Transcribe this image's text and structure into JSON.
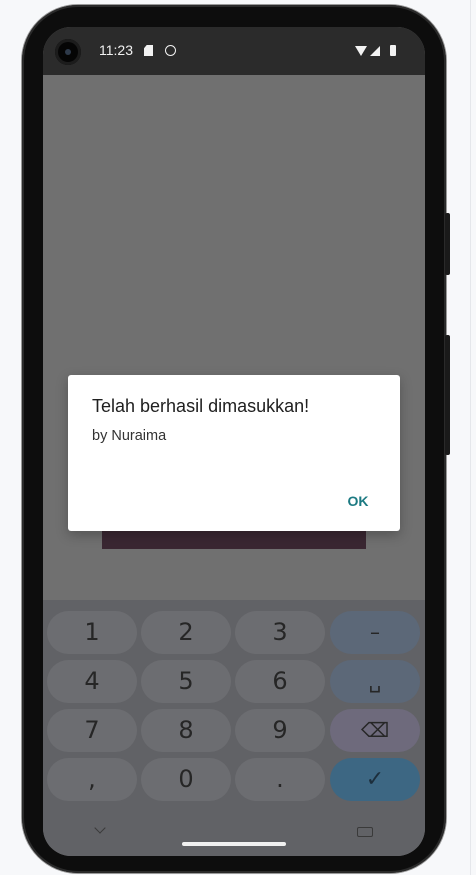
{
  "status_bar": {
    "time": "11:23",
    "icons": [
      "sd-card-icon",
      "face-icon",
      "wifi-icon",
      "signal-icon",
      "battery-icon"
    ]
  },
  "dialog": {
    "title": "Telah berhasil dimasukkan!",
    "message": "by Nuraima",
    "ok_label": "OK"
  },
  "keyboard": {
    "rows": [
      [
        "1",
        "2",
        "3",
        "–"
      ],
      [
        "4",
        "5",
        "6",
        "␣"
      ],
      [
        "7",
        "8",
        "9",
        "⌫"
      ],
      [
        ",",
        "0",
        ".",
        "✓"
      ]
    ]
  },
  "navigation": {
    "icons": [
      "chevron-down-icon",
      "keyboard-icon"
    ]
  },
  "colors": {
    "scrim": "#707070",
    "status_bar": "#2b2b2b",
    "dialog_background": "#ffffff",
    "ok_button_text": "#1c7a82",
    "enter_key": "#3d6783"
  }
}
